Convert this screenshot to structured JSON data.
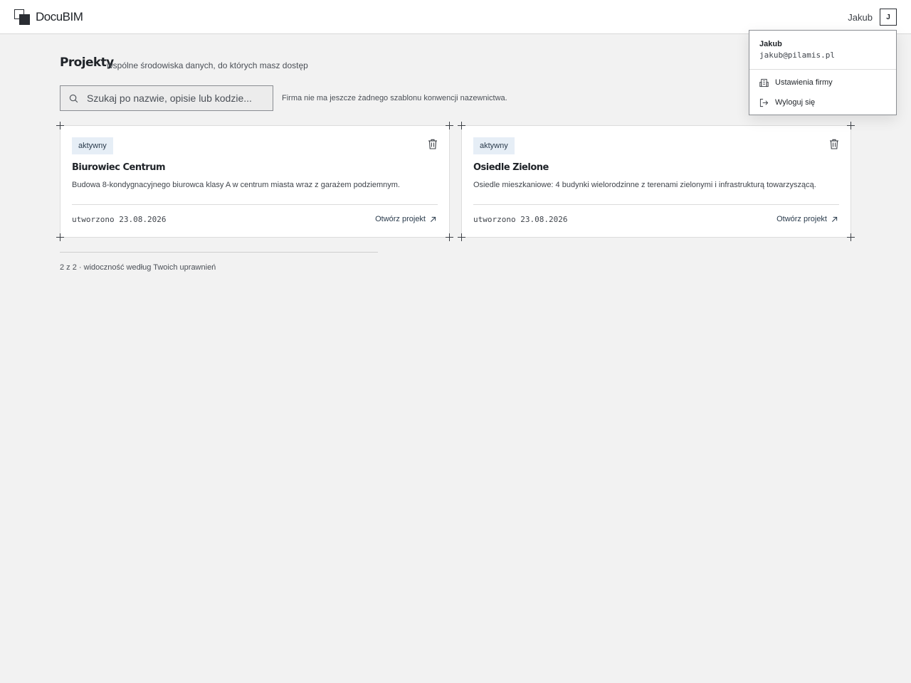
{
  "app": {
    "name": "DocuBIM"
  },
  "header": {
    "user_name": "Jakub",
    "avatar_initial": "J"
  },
  "page": {
    "title": "Projekty",
    "subtitle": "wspólne środowiska danych, do których masz dostęp"
  },
  "search": {
    "placeholder": "Szukaj po nazwie, opisie lub kodzie...",
    "value": ""
  },
  "naming_note": "Firma nie ma jeszcze żadnego szablonu konwencji nazewnictwa.",
  "projects": [
    {
      "status": "aktywny",
      "name": "Biurowiec Centrum",
      "description": "Budowa 8-kondygnacyjnego biurowca klasy A w centrum miasta wraz z garażem podziemnym.",
      "created": "utworzono 23.08.2026",
      "open_label": "Otwórz projekt"
    },
    {
      "status": "aktywny",
      "name": "Osiedle Zielone",
      "description": "Osiedle mieszkaniowe: 4 budynki wielorodzinne z terenami zielonymi i infrastrukturą towarzyszącą.",
      "created": "utworzono 23.08.2026",
      "open_label": "Otwórz projekt"
    }
  ],
  "footer": {
    "count_note": "2 z 2 · widoczność według Twoich uprawnień"
  },
  "user_menu": {
    "name": "Jakub",
    "email": "jakub@pilamis.pl",
    "items": [
      {
        "label": "Ustawienia firmy",
        "icon": "building-icon"
      },
      {
        "label": "Wyloguj się",
        "icon": "logout-icon"
      }
    ]
  },
  "colors": {
    "accent": "#2a3b4c",
    "badge_bg": "#e6eef6",
    "background": "#f2f2f2"
  }
}
